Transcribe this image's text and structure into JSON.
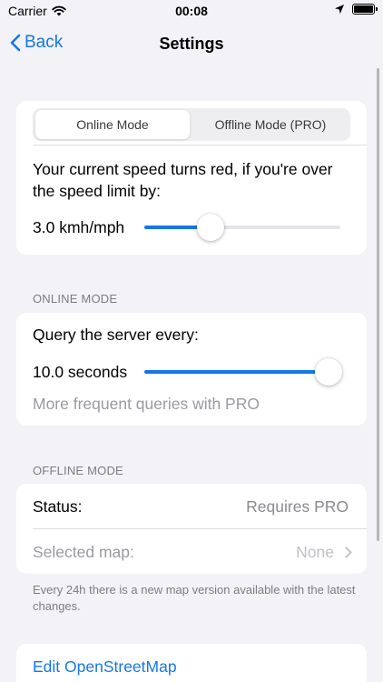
{
  "status_bar": {
    "carrier": "Carrier",
    "time": "00:08"
  },
  "nav": {
    "back_label": "Back",
    "title": "Settings"
  },
  "speed_card": {
    "segments": [
      "Online Mode",
      "Offline Mode (PRO)"
    ],
    "selected_segment": "Online Mode",
    "description": "Your current speed turns red, if you're over the speed limit by:",
    "slider_label": "3.0 kmh/mph",
    "slider_fraction": 0.34
  },
  "online_section": {
    "header": "ONLINE MODE",
    "query_label": "Query the server every:",
    "slider_label": "10.0 seconds",
    "slider_fraction": 1.0,
    "pro_note": "More frequent queries with PRO"
  },
  "offline_section": {
    "header": "OFFLINE MODE",
    "status_label": "Status:",
    "status_value": "Requires PRO",
    "map_label": "Selected map:",
    "map_value": "None",
    "footnote": "Every 24h there is a new map version available with the latest changes."
  },
  "links": {
    "edit_osm": "Edit OpenStreetMap"
  },
  "colors": {
    "accent": "#1677E5",
    "background": "#F2F2F7",
    "secondary_text": "#8A8A8F"
  }
}
